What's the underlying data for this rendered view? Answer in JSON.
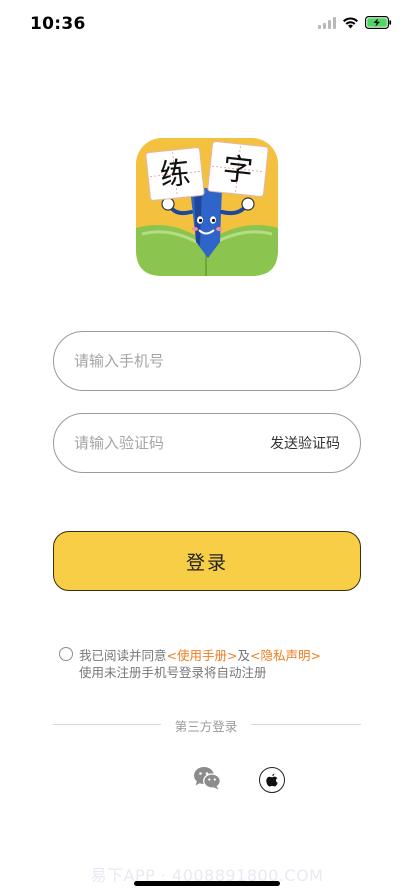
{
  "status_bar": {
    "time": "10:36"
  },
  "logo": {
    "char1": "练",
    "char2": "字"
  },
  "phone_input": {
    "placeholder": "请输入手机号",
    "value": ""
  },
  "code_input": {
    "placeholder": "请输入验证码",
    "value": "",
    "send_code_label": "发送验证码"
  },
  "login_button": {
    "label": "登录"
  },
  "agreement": {
    "checked": false,
    "text_prefix": "我已阅读并同意",
    "manual_link": "<使用手册>",
    "conjunction": "及",
    "privacy_link": "<隐私声明>",
    "note": "使用未注册手机号登录将自动注册"
  },
  "third_party": {
    "label": "第三方登录",
    "icons": [
      "wechat-icon",
      "apple-icon"
    ]
  },
  "watermark": "易下APP · 4008891800.COM",
  "colors": {
    "accent_yellow": "#f7ce46",
    "link_orange": "#f07d1f",
    "logo_green": "#8bc550",
    "logo_yellow": "#f4c13f"
  }
}
